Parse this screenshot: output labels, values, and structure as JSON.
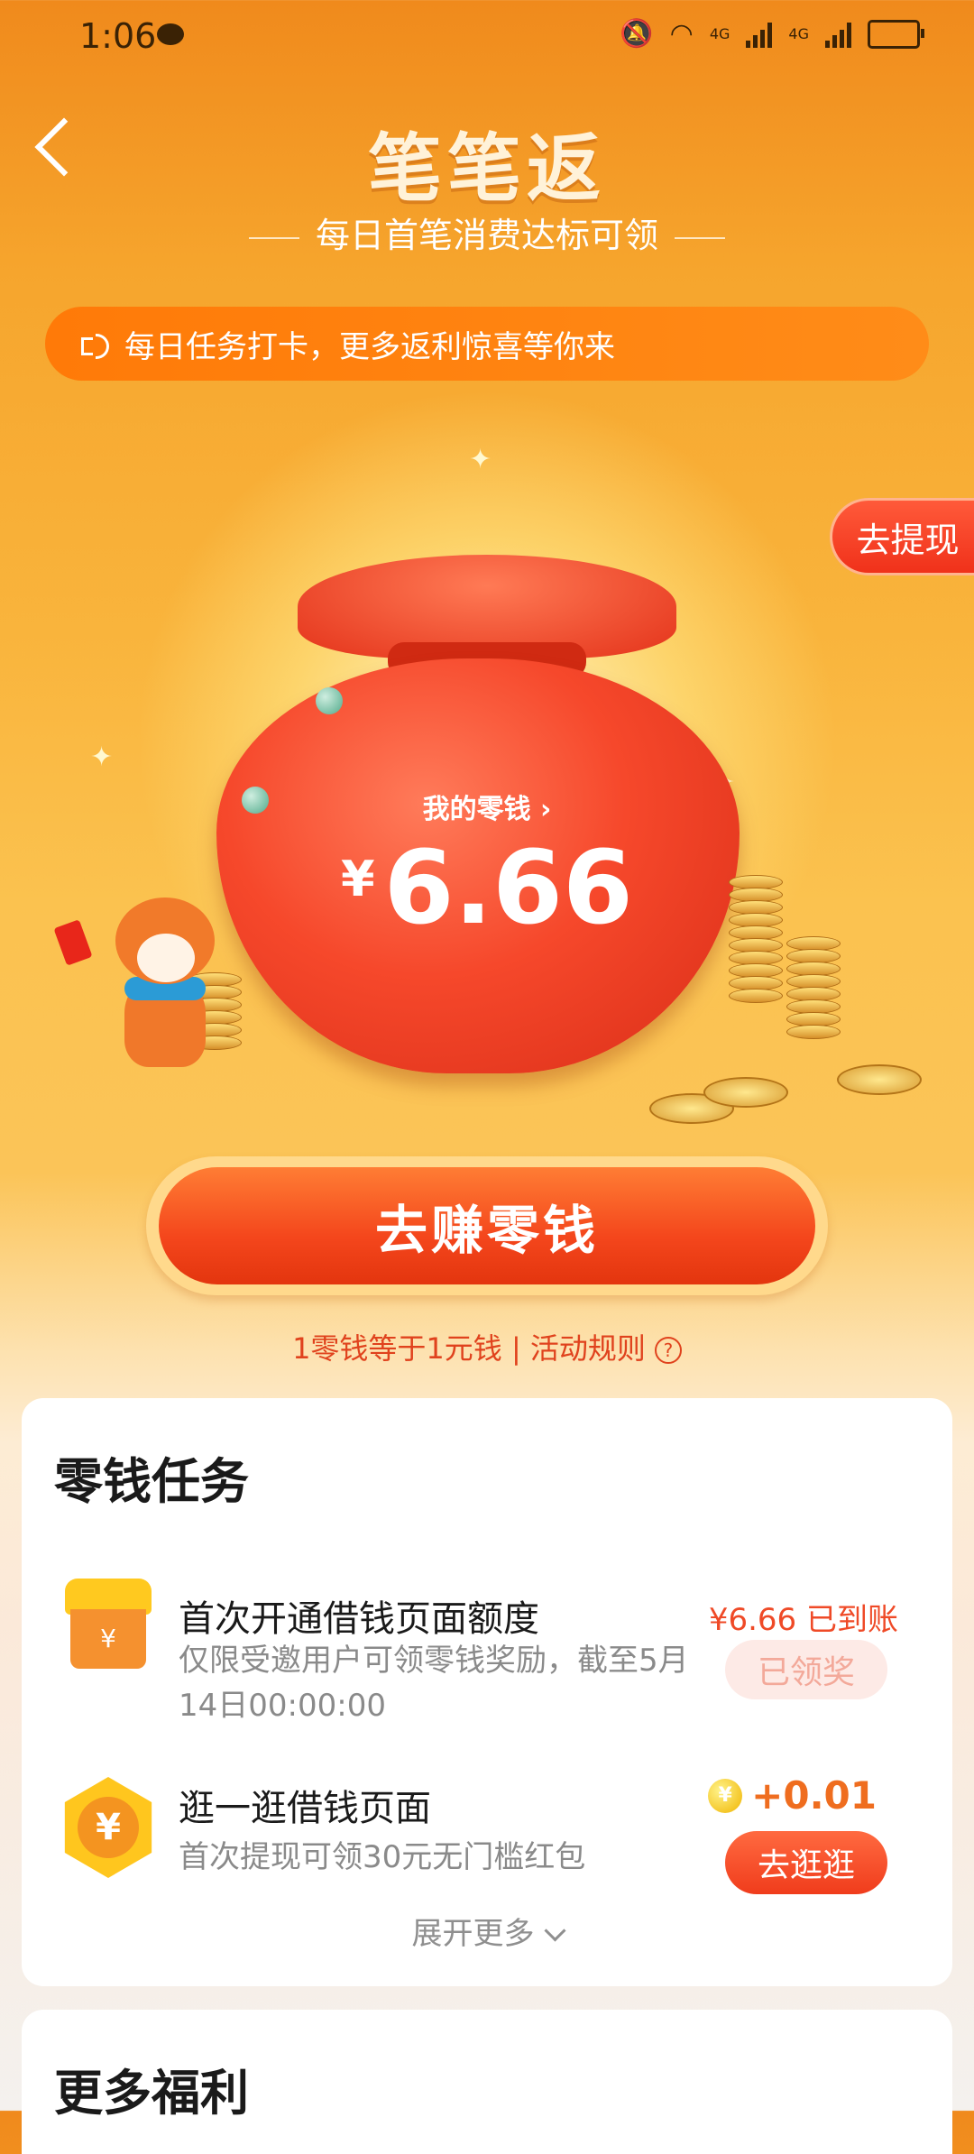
{
  "status_bar": {
    "time": "1:06",
    "network_1": "4G",
    "network_2": "4G"
  },
  "header": {
    "title": "笔笔返",
    "subtitle": "每日首笔消费达标可领"
  },
  "notice": {
    "text": "每日任务打卡，更多返利惊喜等你来"
  },
  "withdraw_button": {
    "label": "去提现"
  },
  "hero": {
    "wallet_label": "我的零钱",
    "currency_symbol": "¥",
    "amount": "6.66"
  },
  "cta": {
    "label": "去赚零钱"
  },
  "rules": {
    "text": "1零钱等于1元钱 | 活动规则",
    "help_glyph": "?"
  },
  "tasks_card": {
    "title": "零钱任务",
    "tasks": [
      {
        "icon": "shop-icon",
        "title": "首次开通借钱页面额度",
        "desc": "仅限受邀用户可领零钱奖励，截至5月14日00:00:00",
        "reward": "¥6.66 已到账",
        "button": "已领奖"
      },
      {
        "icon": "yuan-hex-icon",
        "title": "逛一逛借钱页面",
        "desc": "首次提现可领30元无门槛红包",
        "reward_coin_glyph": "¥",
        "reward": "+0.01",
        "button": "去逛逛"
      }
    ],
    "expand_label": "展开更多"
  },
  "more_card": {
    "title": "更多福利"
  },
  "colors": {
    "accent": "#f4461c",
    "reward_red": "#ef4a27",
    "coin_orange": "#ef6d1f",
    "notice_orange": "#ff7a08"
  }
}
